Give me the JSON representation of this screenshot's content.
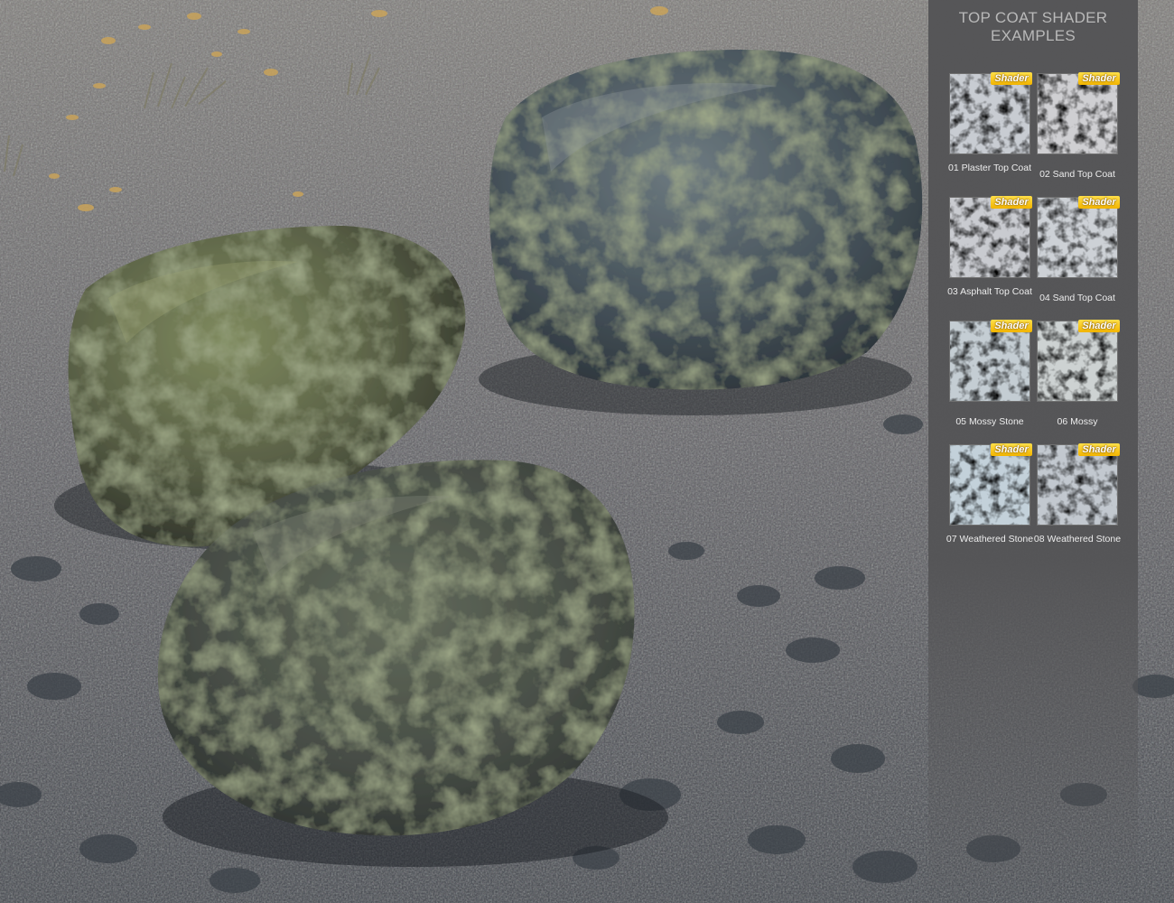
{
  "panel": {
    "title": "TOP COAT SHADER\nEXAMPLES",
    "badge_text": "Shader",
    "badge_color": "#f5c21a",
    "tiles": [
      {
        "label": "01 Plaster Top Coat",
        "tint": "#c8ccd2",
        "fleck": "#6f7378"
      },
      {
        "label": "02 Sand Top Coat",
        "tint": "#cfcfd2",
        "fleck": "#8a8276"
      },
      {
        "label": "03 Asphalt Top Coat",
        "tint": "#c9cbd0",
        "fleck": "#5e6168"
      },
      {
        "label": "04 Sand Top Coat",
        "tint": "#cdd1d6",
        "fleck": "#7c7f86"
      },
      {
        "label": "05 Mossy Stone",
        "tint": "#c4cdd3",
        "fleck": "#5d7280"
      },
      {
        "label": "06 Mossy",
        "tint": "#cdd2d2",
        "fleck": "#8b9a7c"
      },
      {
        "label": "07 Weathered Stone",
        "tint": "#c3d1da",
        "fleck": "#4e6a7a"
      },
      {
        "label": "08 Weathered Stone",
        "tint": "#c2c8cf",
        "fleck": "#4a4f57"
      }
    ]
  }
}
